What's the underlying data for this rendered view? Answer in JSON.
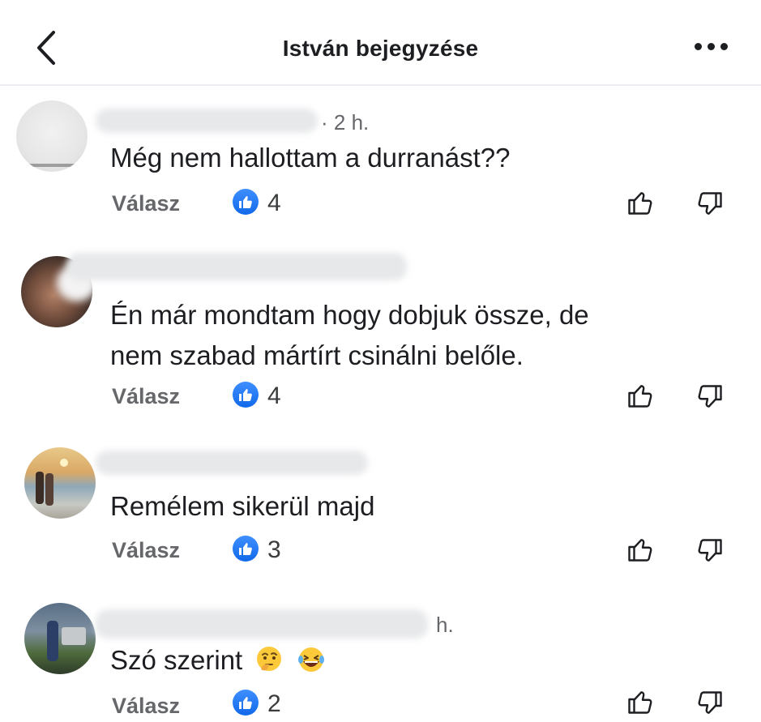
{
  "header": {
    "title": "István bejegyzése",
    "back_icon": "chevron-left-icon",
    "more_icon": "more-horizontal-icon"
  },
  "comments": [
    {
      "time": "· 2 h.",
      "text_lines": [
        "Még nem hallottam a durranást??"
      ],
      "reply_label": "Válasz",
      "likes": "4"
    },
    {
      "time": "",
      "text_lines": [
        "Én már mondtam hogy dobjuk össze, de",
        "nem szabad mártírt csinálni belőle."
      ],
      "reply_label": "Válasz",
      "likes": "4"
    },
    {
      "time": "",
      "text_lines": [
        "Remélem sikerül majd"
      ],
      "reply_label": "Válasz",
      "likes": "3"
    },
    {
      "time": "h.",
      "text_lines": [
        "Szó szerint"
      ],
      "emojis": [
        "thinking-face-icon",
        "laughing-face-icon"
      ],
      "reply_label": "Válasz",
      "likes": "2"
    }
  ],
  "colors": {
    "like_blue": "#1877f2",
    "secondary_text": "#65676b",
    "primary_text": "#1c1e21"
  }
}
